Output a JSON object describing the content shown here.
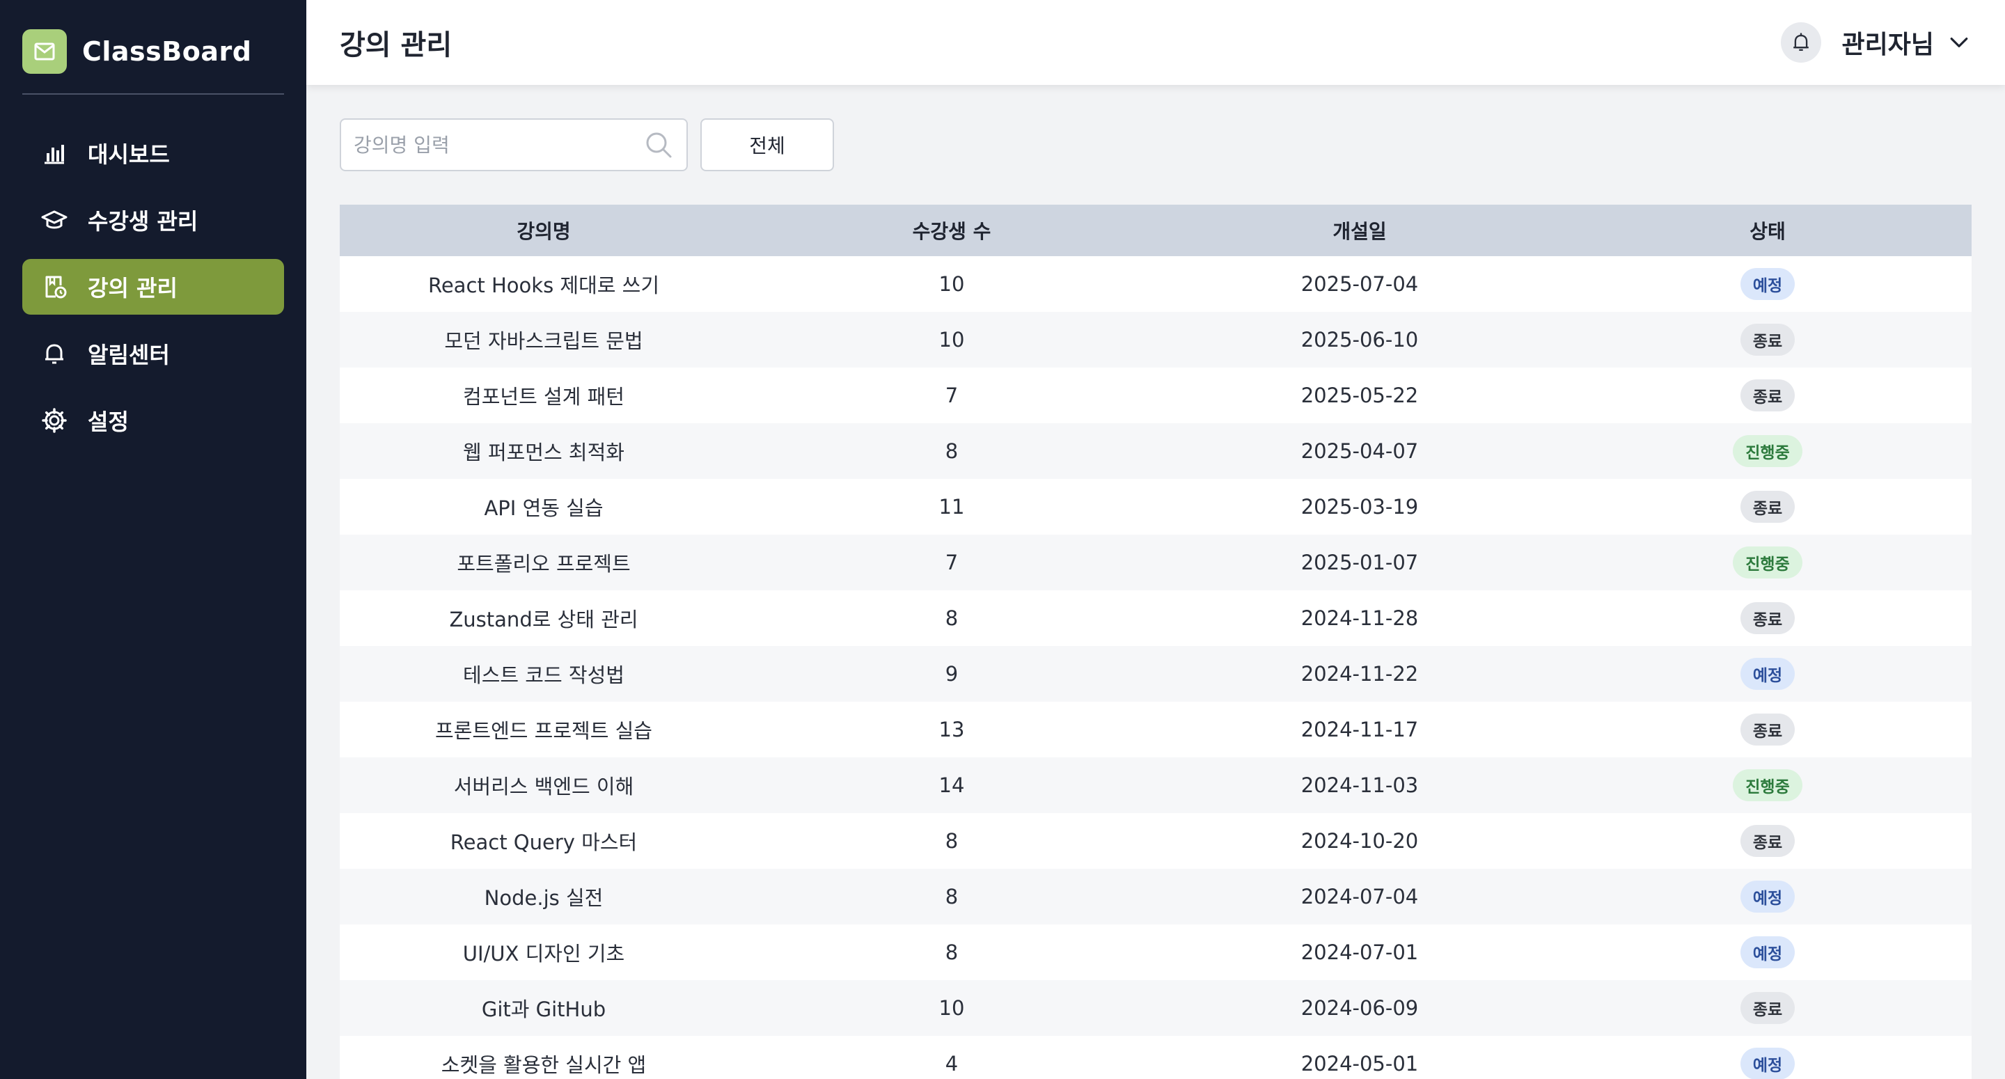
{
  "brand": {
    "name": "ClassBoard"
  },
  "sidebar": {
    "items": [
      {
        "label": "대시보드",
        "icon": "bar-chart-icon",
        "active": false
      },
      {
        "label": "수강생 관리",
        "icon": "graduation-cap-icon",
        "active": false
      },
      {
        "label": "강의 관리",
        "icon": "course-icon",
        "active": true
      },
      {
        "label": "알림센터",
        "icon": "bell-icon",
        "active": false
      },
      {
        "label": "설정",
        "icon": "gear-icon",
        "active": false
      }
    ]
  },
  "header": {
    "title": "강의 관리",
    "user": "관리자님"
  },
  "filters": {
    "search_placeholder": "강의명 입력",
    "status_filter": "전체"
  },
  "table": {
    "columns": [
      "강의명",
      "수강생 수",
      "개설일",
      "상태"
    ],
    "rows": [
      {
        "name": "React Hooks 제대로 쓰기",
        "students": "10",
        "date": "2025-07-04",
        "status": "예정",
        "status_type": "planned"
      },
      {
        "name": "모던 자바스크립트 문법",
        "students": "10",
        "date": "2025-06-10",
        "status": "종료",
        "status_type": "ended"
      },
      {
        "name": "컴포넌트 설계 패턴",
        "students": "7",
        "date": "2025-05-22",
        "status": "종료",
        "status_type": "ended"
      },
      {
        "name": "웹 퍼포먼스 최적화",
        "students": "8",
        "date": "2025-04-07",
        "status": "진행중",
        "status_type": "ongoing"
      },
      {
        "name": "API 연동 실습",
        "students": "11",
        "date": "2025-03-19",
        "status": "종료",
        "status_type": "ended"
      },
      {
        "name": "포트폴리오 프로젝트",
        "students": "7",
        "date": "2025-01-07",
        "status": "진행중",
        "status_type": "ongoing"
      },
      {
        "name": "Zustand로 상태 관리",
        "students": "8",
        "date": "2024-11-28",
        "status": "종료",
        "status_type": "ended"
      },
      {
        "name": "테스트 코드 작성법",
        "students": "9",
        "date": "2024-11-22",
        "status": "예정",
        "status_type": "planned"
      },
      {
        "name": "프론트엔드 프로젝트 실습",
        "students": "13",
        "date": "2024-11-17",
        "status": "종료",
        "status_type": "ended"
      },
      {
        "name": "서버리스 백엔드 이해",
        "students": "14",
        "date": "2024-11-03",
        "status": "진행중",
        "status_type": "ongoing"
      },
      {
        "name": "React Query 마스터",
        "students": "8",
        "date": "2024-10-20",
        "status": "종료",
        "status_type": "ended"
      },
      {
        "name": "Node.js 실전",
        "students": "8",
        "date": "2024-07-04",
        "status": "예정",
        "status_type": "planned"
      },
      {
        "name": "UI/UX 디자인 기초",
        "students": "8",
        "date": "2024-07-01",
        "status": "예정",
        "status_type": "planned"
      },
      {
        "name": "Git과 GitHub",
        "students": "10",
        "date": "2024-06-09",
        "status": "종료",
        "status_type": "ended"
      },
      {
        "name": "소켓을 활용한 실시간 앱",
        "students": "4",
        "date": "2024-05-01",
        "status": "예정",
        "status_type": "planned"
      }
    ]
  },
  "colors": {
    "sidebar_bg": "#141b2d",
    "active_nav": "#7e9a3c",
    "logo_bg": "#a9cf7b",
    "table_header_bg": "#ced5e0"
  }
}
